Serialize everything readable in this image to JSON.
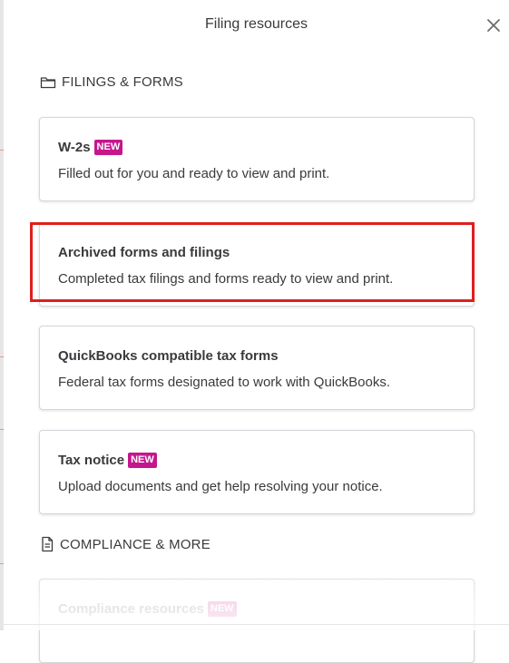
{
  "header": {
    "title": "Filing resources"
  },
  "sections": [
    {
      "label": "FILINGS & FORMS",
      "icon": "folder-icon"
    },
    {
      "label": "COMPLIANCE & MORE",
      "icon": "document-icon"
    }
  ],
  "cards": [
    {
      "title": "W-2s",
      "badge": "NEW",
      "description": "Filled out for you and ready to view and print."
    },
    {
      "title": "Archived forms and filings",
      "badge": "",
      "description": "Completed tax filings and forms ready to view and print."
    },
    {
      "title": "QuickBooks compatible tax forms",
      "badge": "",
      "description": "Federal tax forms designated to work with QuickBooks."
    },
    {
      "title": "Tax notice",
      "badge": "NEW",
      "description": "Upload documents and get help resolving your notice."
    },
    {
      "title": "Compliance resources",
      "badge": "NEW",
      "description": ""
    }
  ],
  "colors": {
    "badge": "#c6168d",
    "highlight": "#e01e1e",
    "text": "#393a3d"
  }
}
